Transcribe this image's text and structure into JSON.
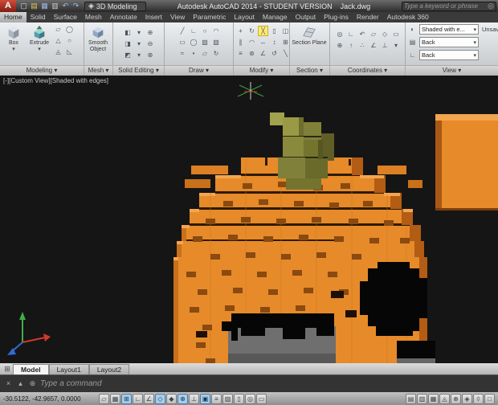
{
  "colors": {
    "pumpkin_orange": "#E78A2A",
    "pumpkin_shadow": "#B25C14",
    "stem_olive": "#8A8A3C",
    "viewport_bg": "#151515",
    "toggle_on_blue": "#A8CDEA",
    "highlight_yellow": "#FFE97A",
    "logo_red": "#C0392B"
  },
  "icons": {
    "chevron_down": "▾",
    "search": "◎"
  },
  "title_bar": {
    "logo": "A",
    "quick_access": [
      {
        "n": "new-file-icon",
        "g": "▢",
        "c": "#d8d8d8"
      },
      {
        "n": "open-file-icon",
        "g": "▤",
        "c": "#e3c25a"
      },
      {
        "n": "save-icon",
        "g": "▦",
        "c": "#9fb3e0"
      },
      {
        "n": "plot-icon",
        "g": "▥",
        "c": "#cccccc"
      },
      {
        "n": "undo-icon",
        "g": "↶",
        "c": "#8fc1ee"
      },
      {
        "n": "redo-icon",
        "g": "↷",
        "c": "#8fc1ee"
      }
    ],
    "workspace": {
      "icon": "◈",
      "label": "3D Modeling"
    },
    "title": "Autodesk AutoCAD 2014 - STUDENT VERSION",
    "doc_name": "Jack.dwg",
    "search": {
      "placeholder": "Type a keyword or phrase"
    }
  },
  "ribbon": {
    "tabs": [
      {
        "n": "tab-home",
        "label": "Home",
        "active": true
      },
      {
        "n": "tab-solid",
        "label": "Solid"
      },
      {
        "n": "tab-surface",
        "label": "Surface"
      },
      {
        "n": "tab-mesh",
        "label": "Mesh"
      },
      {
        "n": "tab-annotate",
        "label": "Annotate"
      },
      {
        "n": "tab-insert",
        "label": "Insert"
      },
      {
        "n": "tab-view",
        "label": "View"
      },
      {
        "n": "tab-parametric",
        "label": "Parametric"
      },
      {
        "n": "tab-layout",
        "label": "Layout"
      },
      {
        "n": "tab-manage",
        "label": "Manage"
      },
      {
        "n": "tab-output",
        "label": "Output"
      },
      {
        "n": "tab-plugins",
        "label": "Plug-ins"
      },
      {
        "n": "tab-render",
        "label": "Render"
      },
      {
        "n": "tab-autodesk360",
        "label": "Autodesk 360"
      }
    ],
    "panels": {
      "modeling": {
        "label": "Modeling ▾",
        "box_label": "Box",
        "extrude_label": "Extrude",
        "icons": [
          {
            "n": "polysolid-icon",
            "g": "▱"
          },
          {
            "n": "cylinder-icon",
            "g": "◯"
          },
          {
            "n": "cone-icon",
            "g": "△"
          },
          {
            "n": "sphere-icon",
            "g": "○"
          },
          {
            "n": "pyramid-icon",
            "g": "◬"
          },
          {
            "n": "wedge-icon",
            "g": "◺"
          }
        ]
      },
      "mesh": {
        "label": "Mesh ▾",
        "smooth_label": "Smooth Object"
      },
      "solid_editing": {
        "label": "Solid Editing ▾",
        "icons": [
          {
            "n": "extrude-faces-icon",
            "g": "◧"
          },
          {
            "n": "chevron-down-icon",
            "g": "▾"
          },
          {
            "n": "union-icon",
            "g": "⊕"
          },
          {
            "n": "move-faces-icon",
            "g": "◨"
          },
          {
            "n": "chevron-down-icon",
            "g": "▾"
          },
          {
            "n": "subtract-icon",
            "g": "⊖"
          },
          {
            "n": "offset-faces-icon",
            "g": "◩"
          },
          {
            "n": "chevron-down-icon",
            "g": "▾"
          },
          {
            "n": "intersect-icon",
            "g": "⊗"
          }
        ]
      },
      "draw": {
        "label": "Draw ▾",
        "icons": [
          {
            "n": "line-icon",
            "g": "╱"
          },
          {
            "n": "polyline-icon",
            "g": "∟"
          },
          {
            "n": "circle-icon",
            "g": "○"
          },
          {
            "n": "arc-icon",
            "g": "◠"
          },
          {
            "n": "rectangle-icon",
            "g": "▭"
          },
          {
            "n": "ellipse-icon",
            "g": "◯"
          },
          {
            "n": "hatch-icon",
            "g": "▨"
          },
          {
            "n": "gradient-icon",
            "g": "▧"
          },
          {
            "n": "spline-icon",
            "g": "≈"
          },
          {
            "n": "point-icon",
            "g": "•"
          },
          {
            "n": "region-icon",
            "g": "▱"
          },
          {
            "n": "helix-icon",
            "g": "↻"
          }
        ]
      },
      "modify": {
        "label": "Modify ▾",
        "icons": [
          {
            "n": "move-icon",
            "g": "+"
          },
          {
            "n": "rotate-icon",
            "g": "↻"
          },
          {
            "n": "trim-icon",
            "g": "╳",
            "hl": true
          },
          {
            "n": "erase-icon",
            "g": "▯"
          },
          {
            "n": "copy-icon",
            "g": "◫"
          },
          {
            "n": "mirror-icon",
            "g": "∥"
          },
          {
            "n": "fillet-icon",
            "g": "◠"
          },
          {
            "n": "stretch-icon",
            "g": "↔"
          },
          {
            "n": "scale-icon",
            "g": "↕"
          },
          {
            "n": "array-icon",
            "g": "⊞"
          },
          {
            "n": "offset-icon",
            "g": "≡"
          },
          {
            "n": "explode-icon",
            "g": "⊛"
          },
          {
            "n": "align-3d-icon",
            "g": "∠"
          },
          {
            "n": "rotate-3d-icon",
            "g": "↺"
          },
          {
            "n": "slice-icon",
            "g": "╲"
          }
        ]
      },
      "section": {
        "label": "Section ▾",
        "plane_label": "Section Plane"
      },
      "coordinates": {
        "label": "Coordinates ▾",
        "icons": [
          {
            "n": "ucs-world-icon",
            "g": "◎"
          },
          {
            "n": "ucs-icon",
            "g": "∟"
          },
          {
            "n": "ucs-previous-icon",
            "g": "↶"
          },
          {
            "n": "ucs-face-icon",
            "g": "▱"
          },
          {
            "n": "ucs-object-icon",
            "g": "◇"
          },
          {
            "n": "ucs-view-icon",
            "g": "▭"
          },
          {
            "n": "ucs-origin-icon",
            "g": "⊕"
          },
          {
            "n": "ucs-zaxis-icon",
            "g": "↑"
          },
          {
            "n": "ucs-3point-icon",
            "g": "∴"
          },
          {
            "n": "ucs-x-icon",
            "g": "∠"
          },
          {
            "n": "ucs-y-icon",
            "g": "⊥"
          },
          {
            "n": "ucs-named-icon",
            "g": "▾"
          }
        ]
      },
      "view": {
        "label": "View ▾",
        "style_value": "Shaded with e...",
        "view_value": "Back",
        "ucs_value": "Back",
        "unsaved_label": "Unsaved"
      }
    }
  },
  "viewport": {
    "label": "[-][Custom View][Shaded with edges]"
  },
  "layout_tabs": {
    "nav_icon": "⊞",
    "items": [
      {
        "n": "tab-model",
        "label": "Model",
        "active": true
      },
      {
        "n": "tab-layout1",
        "label": "Layout1"
      },
      {
        "n": "tab-layout2",
        "label": "Layout2"
      }
    ]
  },
  "command_line": {
    "prompt": "Type a command",
    "icons": [
      {
        "n": "close-command-icon",
        "g": "×"
      },
      {
        "n": "recent-commands-icon",
        "g": "▴"
      },
      {
        "n": "customize-command-icon",
        "g": "⊛"
      }
    ]
  },
  "status_bar": {
    "coordinates": "-30.5122, -42.9657, 0.0000",
    "toggles": [
      {
        "n": "infer-constraints-toggle",
        "g": "▱"
      },
      {
        "n": "snap-toggle",
        "g": "▦"
      },
      {
        "n": "grid-toggle",
        "g": "⊞",
        "on": true
      },
      {
        "n": "ortho-toggle",
        "g": "∟"
      },
      {
        "n": "polar-toggle",
        "g": "∠"
      },
      {
        "n": "osnap-toggle",
        "g": "◇",
        "on": true
      },
      {
        "n": "osnap-3d-toggle",
        "g": "◆"
      },
      {
        "n": "otrack-toggle",
        "g": "⊕",
        "on": true
      },
      {
        "n": "ducs-toggle",
        "g": "⊥"
      },
      {
        "n": "dyn-toggle",
        "g": "▣",
        "on": true
      },
      {
        "n": "lwt-toggle",
        "g": "≡"
      },
      {
        "n": "transparency-toggle",
        "g": "▨"
      },
      {
        "n": "quick-properties-toggle",
        "g": "▯"
      },
      {
        "n": "selection-cycling-toggle",
        "g": "◎"
      },
      {
        "n": "annotation-monitor-toggle",
        "g": "▭"
      }
    ],
    "right_buttons": [
      {
        "n": "model-space-button",
        "g": "▤"
      },
      {
        "n": "quick-view-layouts-button",
        "g": "▥"
      },
      {
        "n": "quick-view-drawings-button",
        "g": "▦"
      },
      {
        "n": "annotation-visibility-button",
        "g": "◬"
      },
      {
        "n": "autoscale-button",
        "g": "⊕"
      },
      {
        "n": "workspace-switching-button",
        "g": "◈"
      },
      {
        "n": "lock-ui-button",
        "g": "◊"
      },
      {
        "n": "clean-screen-button",
        "g": "□"
      }
    ]
  }
}
